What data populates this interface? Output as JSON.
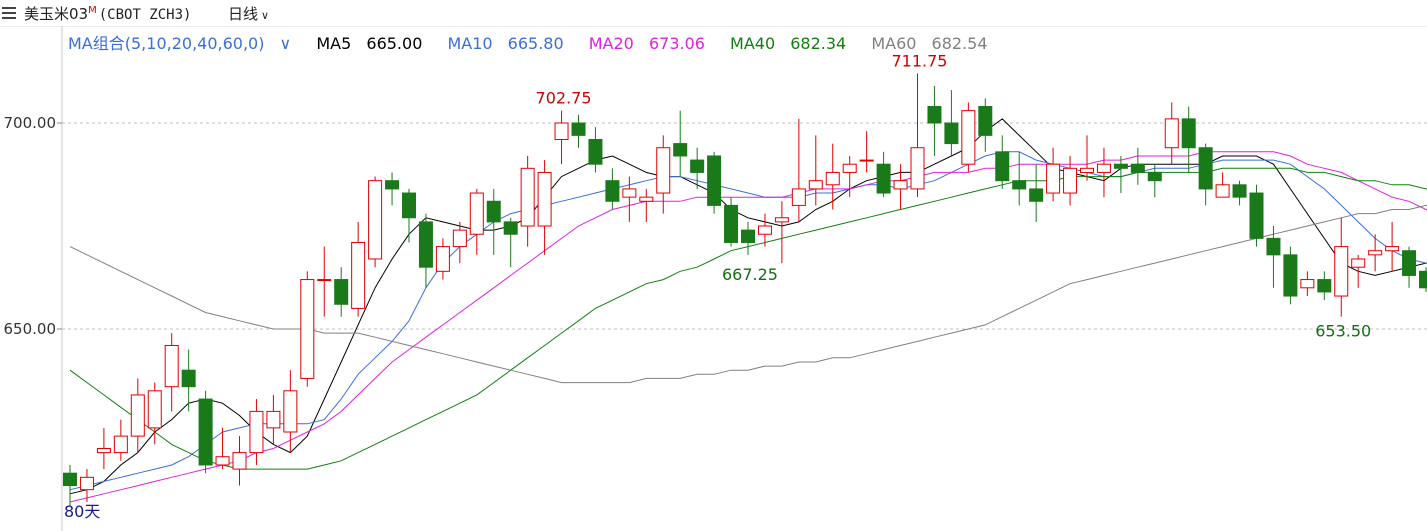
{
  "header": {
    "title": "美玉米03",
    "superscript": "M",
    "code": "(CBOT ZCH3)",
    "period": "日线"
  },
  "legend": {
    "combo": "MA组合(5,10,20,40,60,0)",
    "items": [
      {
        "label": "MA5",
        "value": "665.00",
        "color": "#000000"
      },
      {
        "label": "MA10",
        "value": "665.80",
        "color": "#3a6fd8"
      },
      {
        "label": "MA20",
        "value": "673.06",
        "color": "#e020e0"
      },
      {
        "label": "MA40",
        "value": "682.34",
        "color": "#108010"
      },
      {
        "label": "MA60",
        "value": "682.54",
        "color": "#808080"
      }
    ]
  },
  "chart_data": {
    "type": "candlestick",
    "ylim": [
      607,
      725
    ],
    "yticks": [
      650,
      700
    ],
    "ytick_labels": [
      "650.00",
      "700.00"
    ],
    "grid": "dashed horizontal",
    "up_color": "#e00000",
    "down_color": "#1a7a1a",
    "candles": [
      [
        615,
        612,
        617,
        607
      ],
      [
        611,
        614,
        616,
        608
      ],
      [
        620,
        621,
        626,
        616
      ],
      [
        620,
        624,
        628,
        618
      ],
      [
        624,
        634,
        638,
        620
      ],
      [
        626,
        635,
        637,
        622
      ],
      [
        636,
        646,
        649,
        630
      ],
      [
        640,
        636,
        645,
        630
      ],
      [
        633,
        617,
        635,
        615
      ],
      [
        617,
        619,
        626,
        616
      ],
      [
        616,
        620,
        624,
        612
      ],
      [
        620,
        630,
        633,
        617
      ],
      [
        626,
        630,
        634,
        622
      ],
      [
        625,
        635,
        640,
        620
      ],
      [
        638,
        662,
        664,
        636
      ],
      [
        662,
        662,
        670,
        653
      ],
      [
        662,
        656,
        665,
        653
      ],
      [
        655,
        671,
        676,
        653
      ],
      [
        667,
        686,
        687,
        665
      ],
      [
        686,
        684,
        688,
        680
      ],
      [
        683,
        677,
        684,
        671
      ],
      [
        676,
        665,
        678,
        660
      ],
      [
        664,
        670,
        672,
        662
      ],
      [
        670,
        674,
        676,
        666
      ],
      [
        673,
        683,
        684,
        668
      ],
      [
        681,
        676,
        684,
        668
      ],
      [
        676,
        673,
        677,
        665
      ],
      [
        675,
        689,
        692,
        670
      ],
      [
        675,
        688,
        691,
        668
      ],
      [
        696,
        700,
        703,
        690
      ],
      [
        700,
        697,
        702,
        694
      ],
      [
        696,
        690,
        699,
        688
      ],
      [
        686,
        681,
        689,
        679
      ],
      [
        682,
        684,
        687,
        676
      ],
      [
        681,
        682,
        684,
        676
      ],
      [
        683,
        694,
        697,
        678
      ],
      [
        695,
        692,
        703,
        687
      ],
      [
        691,
        688,
        694,
        684
      ],
      [
        692,
        680,
        693,
        678
      ],
      [
        680,
        671,
        682,
        670
      ],
      [
        674,
        671,
        676,
        668
      ],
      [
        673,
        675,
        678,
        670
      ],
      [
        676,
        677,
        681,
        666
      ],
      [
        680,
        684,
        701,
        676
      ],
      [
        684,
        686,
        697,
        680
      ],
      [
        685,
        688,
        695,
        679
      ],
      [
        688,
        690,
        692,
        682
      ],
      [
        691,
        691,
        698,
        688
      ],
      [
        690,
        683,
        693,
        682
      ],
      [
        684,
        686,
        690,
        679
      ],
      [
        684,
        694,
        712,
        682
      ],
      [
        704,
        700,
        709,
        692
      ],
      [
        700,
        695,
        708,
        692
      ],
      [
        690,
        703,
        705,
        688
      ],
      [
        704,
        697,
        706,
        693
      ],
      [
        693,
        686,
        697,
        684
      ],
      [
        686,
        684,
        693,
        680
      ],
      [
        684,
        681,
        690,
        676
      ],
      [
        683,
        690,
        694,
        681
      ],
      [
        683,
        689,
        692,
        680
      ],
      [
        688,
        689,
        697,
        686
      ],
      [
        688,
        690,
        694,
        682
      ],
      [
        690,
        689,
        692,
        683
      ],
      [
        690,
        688,
        694,
        685
      ],
      [
        688,
        686,
        690,
        682
      ],
      [
        694,
        701,
        705,
        690
      ],
      [
        701,
        694,
        704,
        688
      ],
      [
        694,
        684,
        695,
        680
      ],
      [
        682,
        685,
        688,
        682
      ],
      [
        685,
        682,
        686,
        680
      ],
      [
        683,
        672,
        685,
        670
      ],
      [
        672,
        668,
        675,
        660
      ],
      [
        668,
        658,
        670,
        656
      ],
      [
        660,
        662,
        664,
        658
      ],
      [
        662,
        659,
        664,
        657
      ],
      [
        658,
        670,
        677,
        653
      ],
      [
        665,
        667,
        668,
        660
      ],
      [
        668,
        669,
        673,
        664
      ],
      [
        669,
        670,
        676,
        664
      ],
      [
        669,
        663,
        670,
        660
      ],
      [
        664,
        660,
        665,
        659
      ],
      [
        660,
        665,
        667,
        658
      ],
      [
        665,
        670,
        673,
        664
      ],
      [
        669,
        666,
        671,
        664
      ]
    ],
    "ma": [
      {
        "name": "MA5",
        "color": "#000000",
        "values": [
          610,
          611,
          613,
          617,
          620,
          625,
          628,
          632,
          633,
          632,
          629,
          625,
          622,
          620,
          624,
          633,
          642,
          651,
          660,
          667,
          673,
          677,
          676,
          675,
          674,
          674,
          675,
          677,
          682,
          687,
          689,
          691,
          692,
          690,
          688,
          687,
          687,
          685,
          683,
          679,
          677,
          676,
          675,
          676,
          679,
          681,
          684,
          686,
          687,
          688,
          688,
          690,
          692,
          694,
          698,
          701,
          697,
          693,
          689,
          688,
          687,
          686,
          689,
          690,
          690,
          690,
          690,
          690,
          692,
          692,
          692,
          690,
          684,
          678,
          672,
          666,
          664,
          663,
          664,
          665,
          666,
          666,
          666,
          666,
          665
        ]
      },
      {
        "name": "MA10",
        "color": "#3a6fd8",
        "values": [
          611,
          612,
          613,
          614,
          615,
          616,
          617,
          619,
          622,
          625,
          626,
          627,
          627,
          627,
          627,
          628,
          633,
          639,
          643,
          647,
          652,
          660,
          666,
          670,
          673,
          676,
          678,
          679,
          680,
          681,
          682,
          683,
          684,
          685,
          686,
          687,
          687,
          686,
          685,
          684,
          683,
          682,
          682,
          682,
          683,
          683,
          684,
          685,
          685,
          684,
          685,
          686,
          688,
          690,
          692,
          693,
          693,
          691,
          690,
          689,
          688,
          687,
          687,
          688,
          689,
          689,
          689,
          690,
          691,
          691,
          691,
          691,
          690,
          687,
          684,
          680,
          676,
          672,
          669,
          667,
          666,
          665,
          665,
          666,
          665
        ]
      },
      {
        "name": "MA20",
        "color": "#e020e0",
        "values": [
          608,
          609,
          610,
          611,
          612,
          613,
          614,
          615,
          616,
          617,
          618,
          620,
          621,
          623,
          625,
          627,
          630,
          634,
          638,
          642,
          645,
          648,
          651,
          654,
          657,
          660,
          663,
          666,
          669,
          672,
          675,
          677,
          679,
          680,
          681,
          681,
          681,
          682,
          682,
          682,
          682,
          682,
          682,
          683,
          684,
          684,
          684,
          685,
          686,
          686,
          687,
          688,
          688,
          688,
          689,
          689,
          690,
          690,
          690,
          690,
          690,
          691,
          691,
          692,
          692,
          692,
          692,
          693,
          693,
          693,
          693,
          693,
          692,
          690,
          689,
          688,
          686,
          684,
          682,
          681,
          679,
          677,
          676,
          674,
          673
        ]
      },
      {
        "name": "MA40",
        "color": "#108010",
        "values": [
          640,
          637,
          634,
          631,
          628,
          625,
          622,
          620,
          618,
          617,
          616,
          616,
          616,
          616,
          616,
          617,
          618,
          620,
          622,
          624,
          626,
          628,
          630,
          632,
          634,
          637,
          640,
          643,
          646,
          649,
          652,
          655,
          657,
          659,
          661,
          662,
          664,
          665,
          667,
          669,
          670,
          671,
          672,
          673,
          674,
          675,
          676,
          677,
          678,
          679,
          680,
          681,
          682,
          683,
          684,
          685,
          686,
          686,
          686,
          687,
          687,
          687,
          687,
          688,
          688,
          688,
          688,
          688,
          689,
          689,
          689,
          689,
          689,
          688,
          688,
          687,
          686,
          686,
          685,
          685,
          684,
          683,
          683,
          682,
          682
        ]
      },
      {
        "name": "MA60",
        "color": "#808080",
        "values": [
          670,
          668,
          666,
          664,
          662,
          660,
          658,
          656,
          654,
          653,
          652,
          651,
          650,
          650,
          650,
          649,
          649,
          649,
          648,
          647,
          646,
          645,
          644,
          643,
          642,
          641,
          640,
          639,
          638,
          637,
          637,
          637,
          637,
          637,
          638,
          638,
          638,
          639,
          639,
          640,
          640,
          641,
          641,
          642,
          642,
          643,
          643,
          644,
          645,
          646,
          647,
          648,
          649,
          650,
          651,
          653,
          655,
          657,
          659,
          661,
          662,
          663,
          664,
          665,
          666,
          667,
          668,
          669,
          670,
          671,
          672,
          673,
          674,
          675,
          676,
          677,
          678,
          678,
          679,
          679,
          680,
          680,
          681,
          681,
          682
        ]
      }
    ],
    "annotations": [
      {
        "text": "702.75",
        "index": 29,
        "value": 702.75,
        "position": "above",
        "color": "#d00000"
      },
      {
        "text": "711.75",
        "index": 50,
        "value": 711.75,
        "position": "above",
        "color": "#d00000"
      },
      {
        "text": "667.25",
        "index": 40,
        "value": 667.25,
        "position": "below",
        "color": "#107010"
      },
      {
        "text": "653.50",
        "index": 75,
        "value": 653.5,
        "position": "below",
        "color": "#107010"
      }
    ],
    "visible_bars_label": "80天"
  }
}
